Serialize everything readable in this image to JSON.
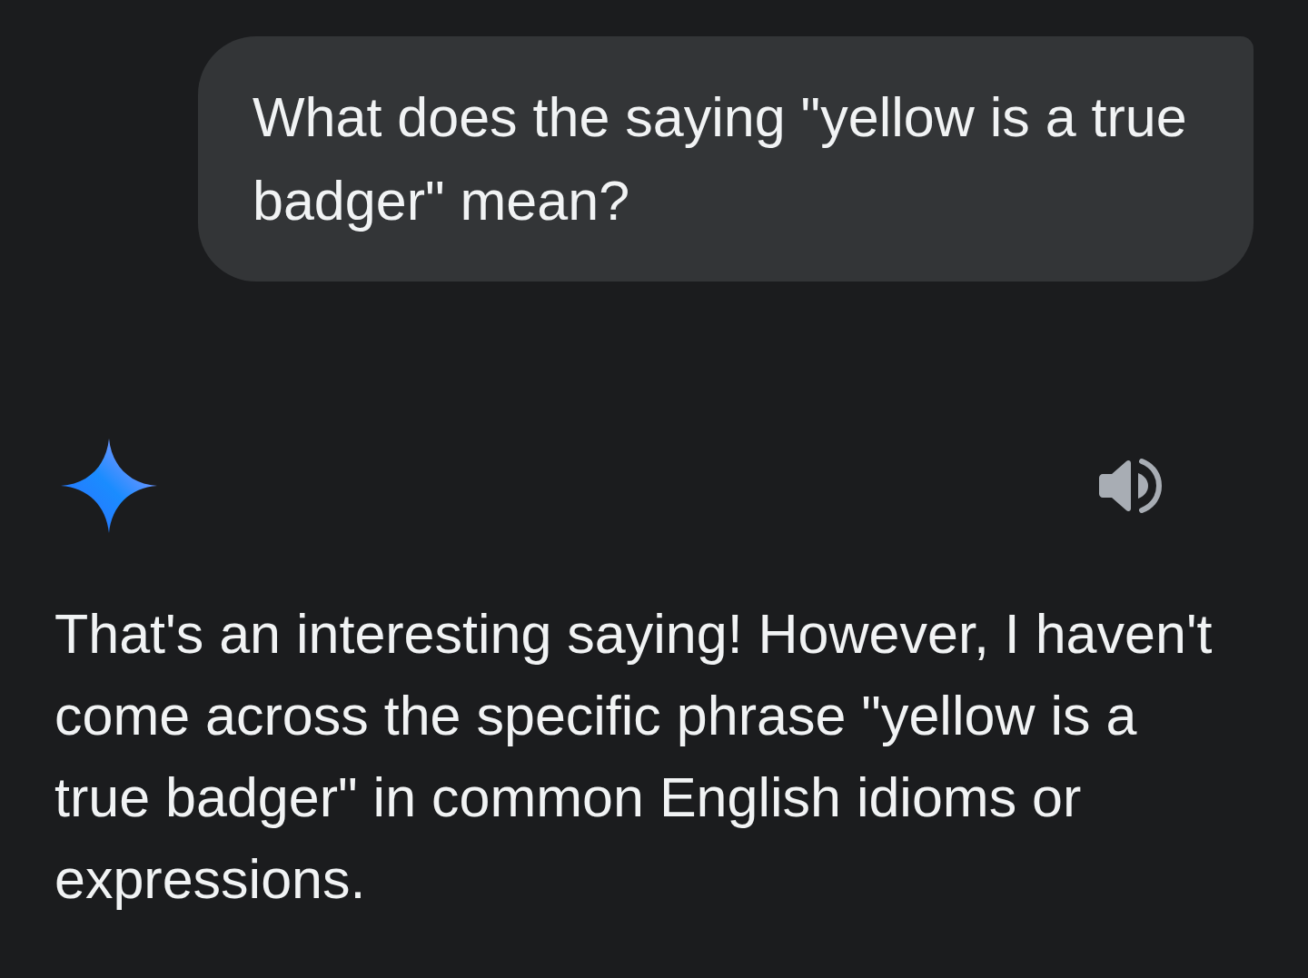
{
  "user_message": {
    "text": "What does the saying \"yellow is a true badger\" mean?"
  },
  "response": {
    "text": "That's an interesting saying! However, I haven't come across the specific phrase \"yellow is a true badger\" in common English idioms or expressions."
  }
}
